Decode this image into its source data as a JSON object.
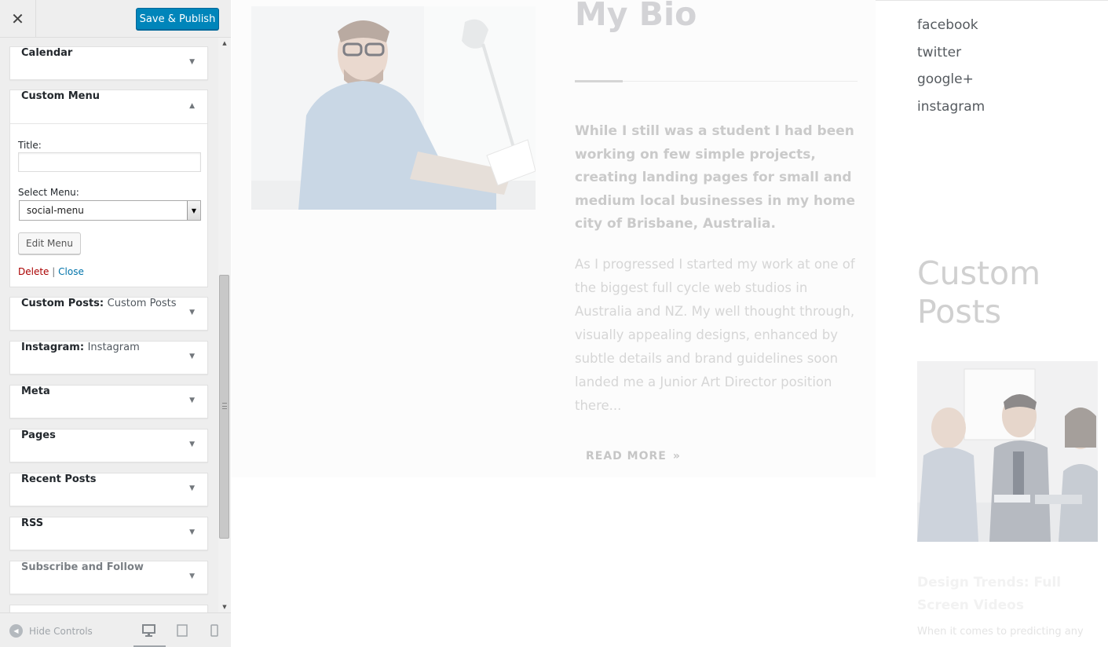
{
  "header": {
    "close_icon": "close-icon",
    "save_label": "Save & Publish",
    "save_color": "#0085ba"
  },
  "widgets": {
    "calendar": {
      "title": "Calendar"
    },
    "custom_menu": {
      "title": "Custom Menu",
      "title_label": "Title:",
      "title_value": "",
      "select_label": "Select Menu:",
      "select_value": "social-menu",
      "edit_label": "Edit Menu",
      "delete_label": "Delete",
      "separator": "|",
      "close_label": "Close"
    },
    "custom_posts": {
      "title": "Custom Posts:",
      "subtitle": "Custom Posts"
    },
    "instagram": {
      "title": "Instagram:",
      "subtitle": "Instagram"
    },
    "meta": {
      "title": "Meta"
    },
    "pages": {
      "title": "Pages"
    },
    "recent_posts": {
      "title": "Recent Posts"
    },
    "rss": {
      "title": "RSS"
    },
    "subscribe": {
      "title": "Subscribe and Follow"
    }
  },
  "footer": {
    "hide_controls_label": "Hide Controls",
    "devices": [
      "desktop-icon",
      "tablet-icon",
      "mobile-icon"
    ],
    "active_device": "desktop"
  },
  "preview": {
    "bio": {
      "title": "My Bio",
      "lead": "While I still was a student I had been working on few simple projects, creating landing pages for small and medium local businesses in my home city of Brisbane, Australia.",
      "body": "As I progressed I started my work at one of the biggest full cycle web studios in Australia and NZ. My well thought through, visually appealing designs, enhanced by subtle details and brand guidelines soon landed me a Junior Art Director position there...",
      "read_more": "READ MORE",
      "read_more_icon": "»"
    },
    "social": [
      "facebook",
      "twitter",
      "google+",
      "instagram"
    ],
    "custom_posts": {
      "title": "Custom Posts",
      "post_title": "Design Trends: Full Screen Videos",
      "post_excerpt": "When it comes to predicting any"
    }
  }
}
